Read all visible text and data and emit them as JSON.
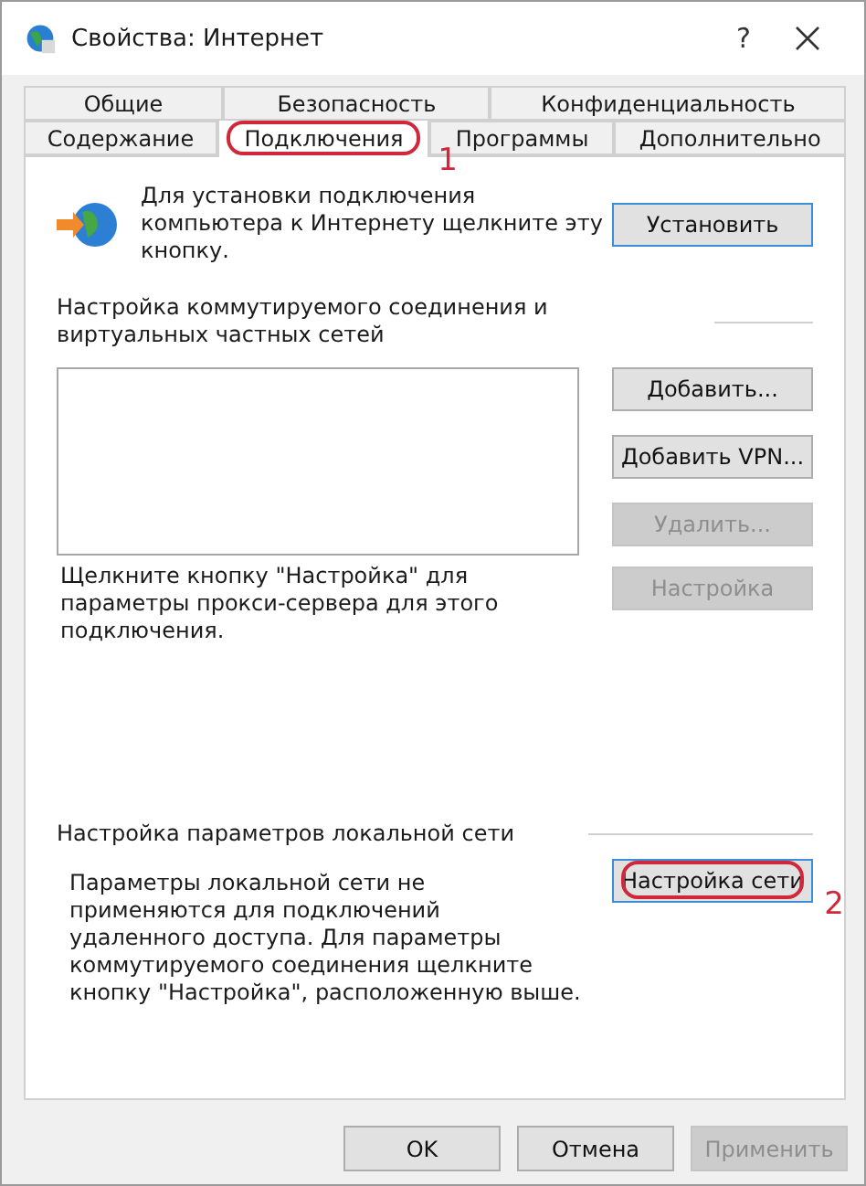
{
  "window": {
    "title": "Свойства: Интернет",
    "help": "?"
  },
  "tab_rows": [
    [
      {
        "label": "Общие",
        "selected": false
      },
      {
        "label": "Безопасность",
        "selected": false
      },
      {
        "label": "Конфиденциальность",
        "selected": false
      }
    ],
    [
      {
        "label": "Содержание",
        "selected": false
      },
      {
        "label": "Подключения",
        "selected": true,
        "callout": "1"
      },
      {
        "label": "Программы",
        "selected": false
      },
      {
        "label": "Дополнительно",
        "selected": false
      }
    ]
  ],
  "setup": {
    "text": "Для установки подключения компьютера к Интернету щелкните эту кнопку.",
    "button": {
      "label": "Установить",
      "disabled": false
    }
  },
  "dialup": {
    "heading": "Настройка коммутируемого соединения и виртуальных частных сетей",
    "buttons": [
      {
        "label": "Добавить...",
        "disabled": false
      },
      {
        "label": "Добавить VPN...",
        "disabled": false
      },
      {
        "label": "Удалить...",
        "disabled": true
      }
    ],
    "proxy_text": "Щелкните кнопку \"Настройка\" для параметры прокси-сервера для этого подключения.",
    "proxy_button": {
      "label": "Настройка",
      "disabled": true
    }
  },
  "lan": {
    "heading": "Настройка параметров локальной сети",
    "text": "Параметры локальной сети не применяются для подключений удаленного доступа. Для параметры коммутируемого соединения щелкните кнопку \"Настройка\", расположенную выше.",
    "button": {
      "label": "Настройка сети",
      "disabled": false,
      "callout": "2"
    }
  },
  "footer_buttons": [
    {
      "label": "OK",
      "disabled": false
    },
    {
      "label": "Отмена",
      "disabled": false
    },
    {
      "label": "Применить",
      "disabled": true
    }
  ]
}
